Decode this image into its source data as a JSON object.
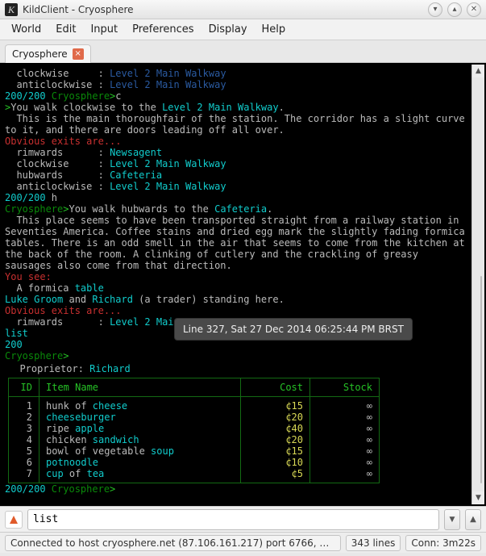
{
  "window": {
    "app_icon_letter": "K",
    "title": "KildClient - Cryosphere",
    "buttons": {
      "min": "▾",
      "max": "▴",
      "close": "✕"
    }
  },
  "menu": [
    "World",
    "Edit",
    "Input",
    "Preferences",
    "Display",
    "Help"
  ],
  "tab": {
    "label": "Cryosphere",
    "close": "×"
  },
  "terminal": {
    "exit_label_lines": [
      {
        "dir": "clockwise",
        "dest": "Level 2 Main Walkway"
      },
      {
        "dir": "anticlockwise",
        "dest": "Level 2 Main Walkway"
      }
    ],
    "hp1": "200/200",
    "prompt_world": "Cryosphere",
    "cmd1": "c",
    "walk1_a": "You walk clockwise to the ",
    "walk1_b": "Level 2 Main Walkway",
    "walk1_c": ".",
    "desc1": "  This is the main thoroughfair of the station. The corridor has a slight curve to it, and there are doors leading off all over.",
    "exits_hdr": "Obvious exits are...",
    "exits2": [
      {
        "dir": "rimwards",
        "dest": "Newsagent"
      },
      {
        "dir": "clockwise",
        "dest": "Level 2 Main Walkway"
      },
      {
        "dir": "hubwards",
        "dest": "Cafeteria"
      },
      {
        "dir": "anticlockwise",
        "dest": "Level 2 Main Walkway"
      }
    ],
    "hp2": "200/200",
    "cmd2": "h",
    "walk2_a": "You walk hubwards to the ",
    "walk2_b": "Cafeteria",
    "walk2_c": ".",
    "desc2": "  This place seems to have been transported straight from a railway station in Seventies America. Coffee stains and dried egg mark the slightly fading formica tables. There is an odd smell in the air that seems to come from the kitchen at the back of the room. A clinking of cutlery and the crackling of greasy sausages also come from that direction.",
    "yousee": "You see:",
    "see_a": "  A formica ",
    "see_b": "table",
    "npc1": "Luke Groom",
    "npc_and": " and ",
    "npc2": "Richard",
    "npc_tail": " (a trader) standing here.",
    "exits3": [
      {
        "dir": "rimwards",
        "dest": "Level 2 Mai"
      }
    ],
    "cmd3": "list",
    "hp3": "200",
    "hp4": "200/200",
    "shop": {
      "prop_label": "Proprietor",
      "prop_value": "Richard",
      "headers": {
        "id": "ID",
        "name": "Item Name",
        "cost": "Cost",
        "stock": "Stock"
      },
      "rows": [
        {
          "id": "1",
          "pre": "hunk of ",
          "hi": "cheese",
          "post": "",
          "cost": "¢15",
          "stock": "∞"
        },
        {
          "id": "2",
          "pre": "",
          "hi": "cheeseburger",
          "post": "",
          "cost": "¢20",
          "stock": "∞"
        },
        {
          "id": "3",
          "pre": "ripe ",
          "hi": "apple",
          "post": "",
          "cost": "¢40",
          "stock": "∞"
        },
        {
          "id": "4",
          "pre": "chicken ",
          "hi": "sandwich",
          "post": "",
          "cost": "¢20",
          "stock": "∞"
        },
        {
          "id": "5",
          "pre": "bowl of vegetable ",
          "hi": "soup",
          "post": "",
          "cost": "¢15",
          "stock": "∞"
        },
        {
          "id": "6",
          "pre": "",
          "hi": "potnoodle",
          "post": "",
          "cost": "¢10",
          "stock": "∞"
        },
        {
          "id": "7",
          "pre": "",
          "hi": "cup",
          "post": " of ",
          "hi2": "tea",
          "cost": "¢5",
          "stock": "∞"
        }
      ]
    },
    "prompt_tail": ">"
  },
  "tooltip": "Line 327, Sat 27 Dec 2014 06:25:44 PM BRST",
  "input": {
    "value": "list"
  },
  "status": {
    "main": "Connected to host cryosphere.net (87.106.161.217) port 6766, …",
    "lines": "343 lines",
    "conn": "Conn: 3m22s"
  }
}
